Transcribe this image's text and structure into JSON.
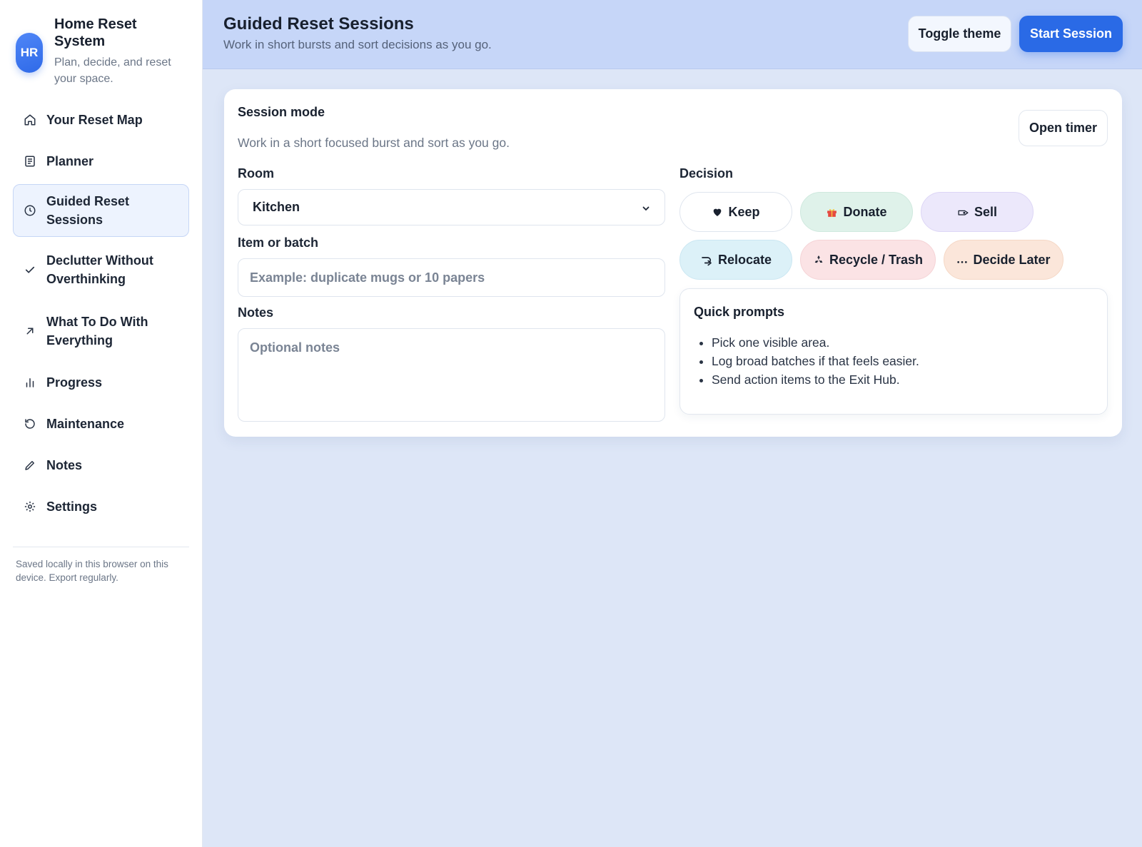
{
  "brand": {
    "initials": "HR",
    "title": "Home Reset System",
    "subtitle": "Plan, decide, and reset your space."
  },
  "sidebar": {
    "items": [
      {
        "label": "Your Reset Map",
        "icon": "home-icon"
      },
      {
        "label": "Planner",
        "icon": "document-icon"
      },
      {
        "label": "Guided Reset Sessions",
        "icon": "clock-icon",
        "active": true
      },
      {
        "label": "Declutter Without Overthinking",
        "icon": "check-icon"
      },
      {
        "label": "What To Do With Everything",
        "icon": "arrow-up-right-icon"
      },
      {
        "label": "Progress",
        "icon": "bar-chart-icon"
      },
      {
        "label": "Maintenance",
        "icon": "refresh-icon"
      },
      {
        "label": "Notes",
        "icon": "pencil-icon"
      },
      {
        "label": "Settings",
        "icon": "gear-icon"
      }
    ],
    "footer": "Saved locally in this browser on this device. Export regularly."
  },
  "header": {
    "title": "Guided Reset Sessions",
    "subtitle": "Work in short bursts and sort decisions as you go.",
    "toggle_label": "Toggle theme",
    "start_label": "Start Session"
  },
  "session": {
    "title": "Session mode",
    "subtitle": "Work in a short focused burst and sort as you go.",
    "timer_label": "Open timer",
    "room_label": "Room",
    "room_value": "Kitchen",
    "item_label": "Item or batch",
    "item_placeholder": "Example: duplicate mugs or 10 papers",
    "notes_label": "Notes",
    "notes_placeholder": "Optional notes"
  },
  "decision": {
    "label": "Decision",
    "options": [
      {
        "label": "Keep",
        "icon": "heart-icon"
      },
      {
        "label": "Donate",
        "icon": "gift-icon"
      },
      {
        "label": "Sell",
        "icon": "tag-icon"
      },
      {
        "label": "Relocate",
        "icon": "arrow-return-icon"
      },
      {
        "label": "Recycle / Trash",
        "icon": "recycle-icon"
      },
      {
        "label": "Decide Later",
        "icon": "ellipsis-icon"
      }
    ]
  },
  "quick_prompts": {
    "title": "Quick prompts",
    "items": [
      "Pick one visible area.",
      "Log broad batches if that feels easier.",
      "Send action items to the Exit Hub."
    ]
  },
  "colors": {
    "accent": "#2a6ae6",
    "header_bg": "#c6d6f8",
    "page_bg": "#dde6f7"
  }
}
